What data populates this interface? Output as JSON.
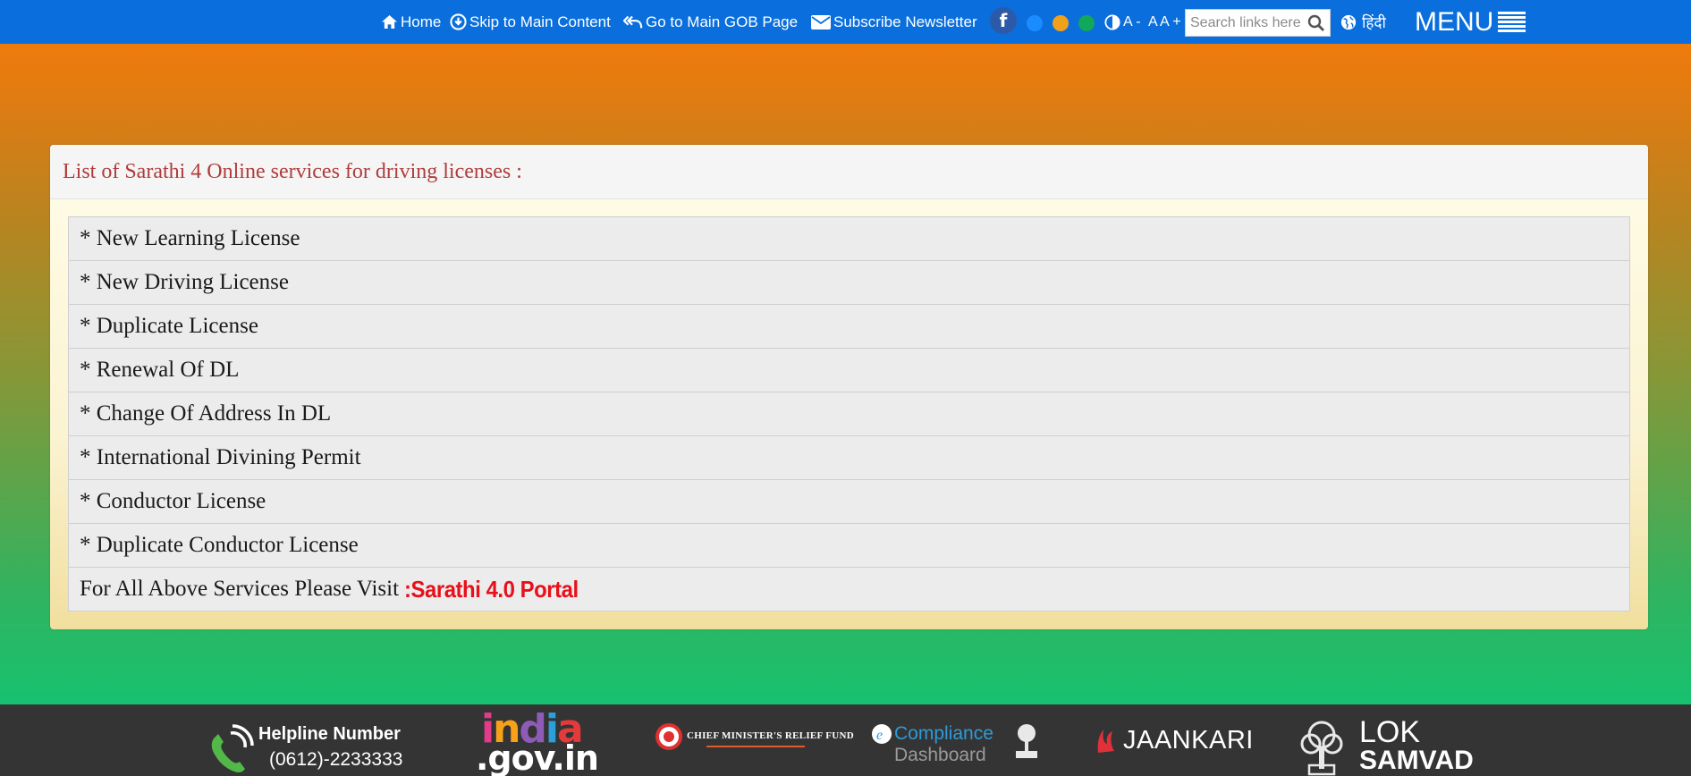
{
  "colors": {
    "topbar_bg": "#0a6fdc",
    "panel_title": "#b03c3c",
    "portal_link": "#e8101a",
    "footer_bg": "#343434",
    "theme_dot_blue": "#1a8cff",
    "theme_dot_orange": "#f0a11c",
    "theme_dot_green": "#11a85a"
  },
  "topbar": {
    "home_label": "Home",
    "skip_label": "Skip to Main Content",
    "gob_label": "Go to Main GOB Page",
    "newsletter_label": "Subscribe Newsletter",
    "facebook_glyph": "f",
    "font_decrease": "A -",
    "font_normal": "A",
    "font_increase": "A +",
    "search_placeholder": "Search links here",
    "language_label": "हिंदी",
    "menu_label": "MENU"
  },
  "panel": {
    "title": "List of Sarathi 4 Online services for driving licenses :",
    "services": [
      "* New Learning License",
      "* New Driving License",
      "* Duplicate License",
      "* Renewal Of DL",
      "* Change Of Address In DL",
      "* International Divining Permit",
      "* Conductor License",
      "* Duplicate Conductor License"
    ],
    "visit_text": "For All Above Services Please Visit",
    "portal_link_text": ":Sarathi 4.0 Portal"
  },
  "footer": {
    "helpline_title": "Helpline Number",
    "helpline_number": "(0612)-2233333",
    "india_top": "india",
    "india_bottom": ".gov.in",
    "cm_relief_fund": "CHIEF MINISTER'S RELIEF FUND",
    "ecompliance_1": "Compliance",
    "ecompliance_2": "Dashboard",
    "jaankari": "JAANKARI",
    "lok_1": "LOK",
    "lok_2": "SAMVAD"
  }
}
